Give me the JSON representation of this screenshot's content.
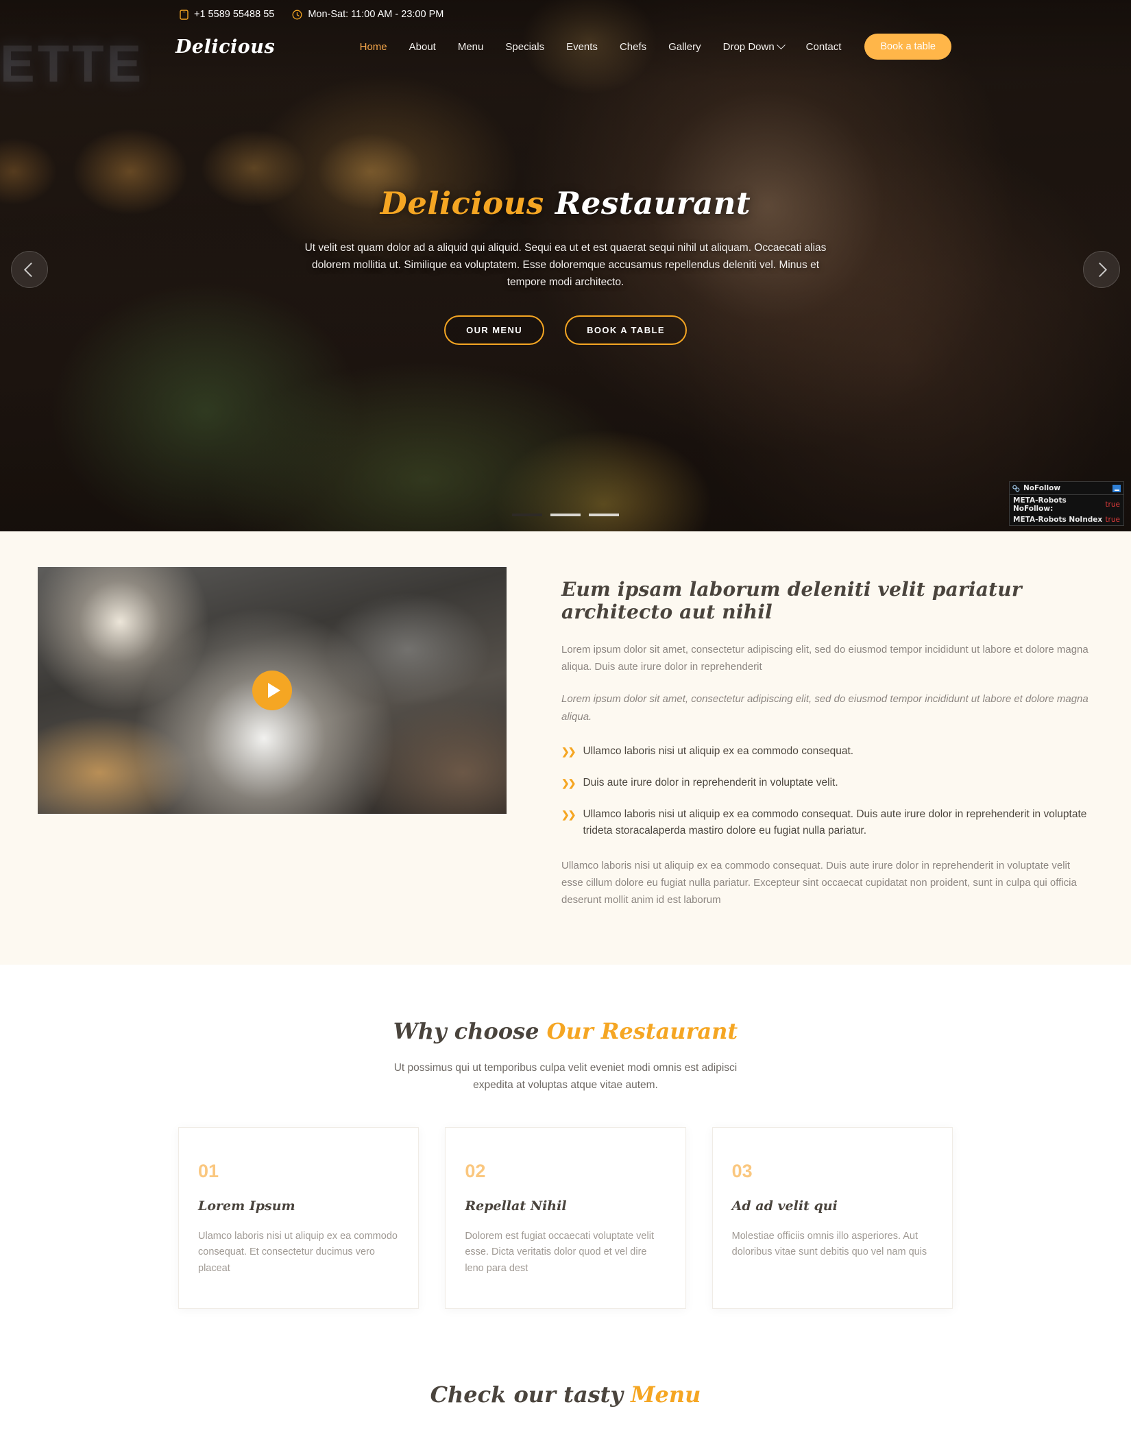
{
  "topbar": {
    "phone": "+1 5589 55488 55",
    "hours": "Mon-Sat: 11:00 AM - 23:00 PM"
  },
  "nav": {
    "brand": "Delicious",
    "links": [
      {
        "label": "Home",
        "active": true
      },
      {
        "label": "About",
        "active": false
      },
      {
        "label": "Menu",
        "active": false
      },
      {
        "label": "Specials",
        "active": false
      },
      {
        "label": "Events",
        "active": false
      },
      {
        "label": "Chefs",
        "active": false
      },
      {
        "label": "Gallery",
        "active": false
      },
      {
        "label": "Drop Down",
        "active": false,
        "dropdown": true
      },
      {
        "label": "Contact",
        "active": false
      }
    ],
    "book_button": "Book a table"
  },
  "hero": {
    "title_accent": "Delicious",
    "title_rest": "Restaurant",
    "subtitle": "Ut velit est quam dolor ad a aliquid qui aliquid. Sequi ea ut et est quaerat sequi nihil ut aliquam. Occaecati alias dolorem mollitia ut. Similique ea voluptatem. Esse doloremque accusamus repellendus deleniti vel. Minus et tempore modi architecto.",
    "btn_menu": "OUR MENU",
    "btn_book": "BOOK A TABLE",
    "sign_text": "ETTE",
    "slides": 3,
    "active_slide": 1
  },
  "nofollow": {
    "title": "NoFollow",
    "rows": [
      {
        "key": "META-Robots NoFollow:",
        "value": "true"
      },
      {
        "key": "META-Robots NoIndex",
        "value": "true"
      }
    ]
  },
  "about": {
    "heading": "Eum ipsam laborum deleniti velit pariatur architecto aut nihil",
    "paragraph1": "Lorem ipsum dolor sit amet, consectetur adipiscing elit, sed do eiusmod tempor incididunt ut labore et dolore magna aliqua. Duis aute irure dolor in reprehenderit",
    "paragraph2": "Lorem ipsum dolor sit amet, consectetur adipiscing elit, sed do eiusmod tempor incididunt ut labore et dolore magna aliqua.",
    "bullets": [
      "Ullamco laboris nisi ut aliquip ex ea commodo consequat.",
      "Duis aute irure dolor in reprehenderit in voluptate velit.",
      "Ullamco laboris nisi ut aliquip ex ea commodo consequat. Duis aute irure dolor in reprehenderit in voluptate trideta storacalaperda mastiro dolore eu fugiat nulla pariatur."
    ],
    "paragraph3": "Ullamco laboris nisi ut aliquip ex ea commodo consequat. Duis aute irure dolor in reprehenderit in voluptate velit esse cillum dolore eu fugiat nulla pariatur. Excepteur sint occaecat cupidatat non proident, sunt in culpa qui officia deserunt mollit anim id est laborum"
  },
  "why": {
    "title_plain": "Why choose ",
    "title_accent": "Our Restaurant",
    "subtitle": "Ut possimus qui ut temporibus culpa velit eveniet modi omnis est adipisci expedita at voluptas atque vitae autem.",
    "cards": [
      {
        "number": "01",
        "title": "Lorem Ipsum",
        "body": "Ulamco laboris nisi ut aliquip ex ea commodo consequat. Et consectetur ducimus vero placeat"
      },
      {
        "number": "02",
        "title": "Repellat Nihil",
        "body": "Dolorem est fugiat occaecati voluptate velit esse. Dicta veritatis dolor quod et vel dire leno para dest"
      },
      {
        "number": "03",
        "title": "Ad ad velit qui",
        "body": "Molestiae officiis omnis illo asperiores. Aut doloribus vitae sunt debitis quo vel nam quis"
      }
    ]
  },
  "menu_teaser": {
    "title_plain": "Check our tasty ",
    "title_accent": "Menu"
  },
  "colors": {
    "accent": "#f5a623",
    "accent_button": "#ffb649",
    "accent_light": "#fac77f",
    "about_bg": "#fdf9f1",
    "text_dark": "#4a443d",
    "text_muted": "#8d8681"
  }
}
